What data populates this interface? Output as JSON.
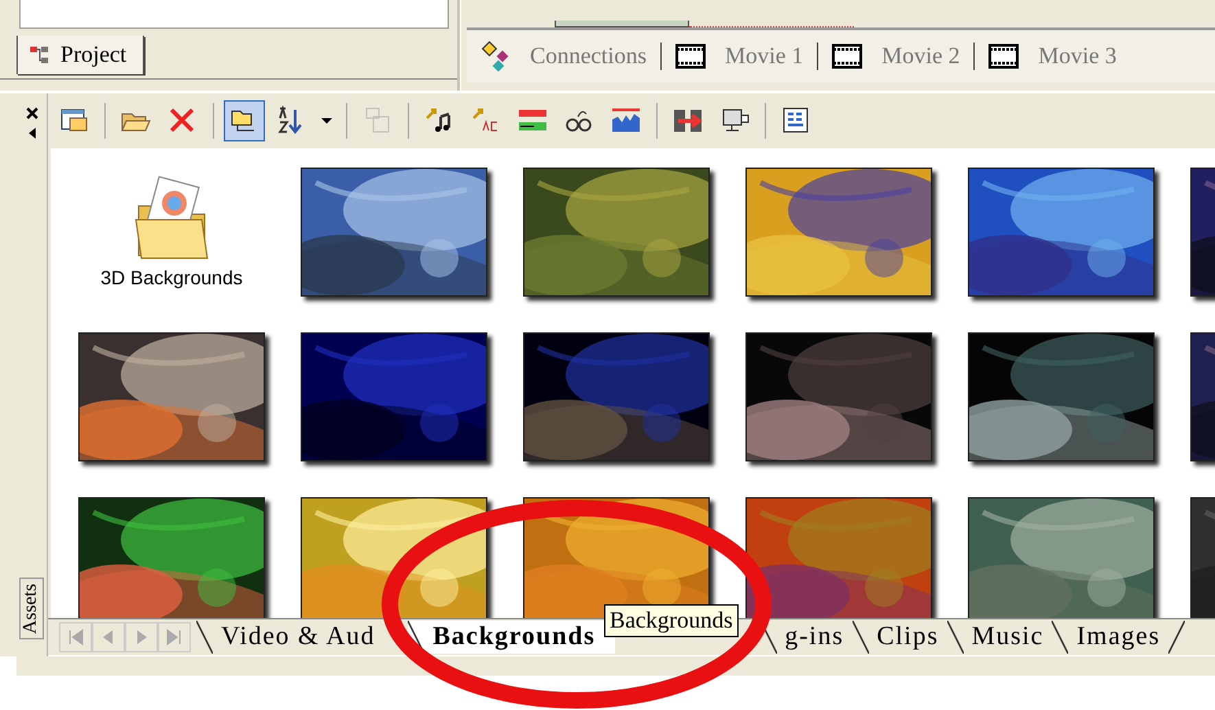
{
  "project_tabs": [
    {
      "label": "Project",
      "selected": true
    }
  ],
  "document_tabs": [
    {
      "kind": "connections",
      "label": "Connections"
    },
    {
      "kind": "movie",
      "label": "Movie 1"
    },
    {
      "kind": "movie",
      "label": "Movie 2"
    },
    {
      "kind": "movie",
      "label": "Movie 3"
    }
  ],
  "toolbar": [
    {
      "kind": "view",
      "selected": false,
      "disabled": false
    },
    {
      "kind": "separator"
    },
    {
      "kind": "open",
      "selected": false,
      "disabled": false
    },
    {
      "kind": "delete",
      "selected": false,
      "disabled": false
    },
    {
      "kind": "separator"
    },
    {
      "kind": "folder-view",
      "selected": true,
      "disabled": false
    },
    {
      "kind": "sort",
      "selected": false,
      "disabled": false
    },
    {
      "kind": "dropdown",
      "selected": false,
      "disabled": false
    },
    {
      "kind": "separator"
    },
    {
      "kind": "windows",
      "selected": false,
      "disabled": true
    },
    {
      "kind": "separator"
    },
    {
      "kind": "audio",
      "selected": false,
      "disabled": false
    },
    {
      "kind": "ac3",
      "selected": false,
      "disabled": false
    },
    {
      "kind": "bars",
      "selected": false,
      "disabled": false
    },
    {
      "kind": "glasses",
      "selected": false,
      "disabled": false
    },
    {
      "kind": "wave",
      "selected": false,
      "disabled": false
    },
    {
      "kind": "separator"
    },
    {
      "kind": "film",
      "selected": false,
      "disabled": false
    },
    {
      "kind": "monitor",
      "selected": false,
      "disabled": false
    },
    {
      "kind": "separator"
    },
    {
      "kind": "grid",
      "selected": false,
      "disabled": false
    }
  ],
  "assets": {
    "title": "Assets",
    "items": [
      {
        "kind": "folder",
        "label": "3D Backgrounds"
      },
      {
        "kind": "picture"
      },
      {
        "kind": "picture"
      },
      {
        "kind": "picture"
      },
      {
        "kind": "picture"
      },
      {
        "kind": "picture"
      },
      {
        "kind": "picture"
      },
      {
        "kind": "picture"
      },
      {
        "kind": "picture"
      },
      {
        "kind": "picture"
      },
      {
        "kind": "picture"
      },
      {
        "kind": "picture"
      },
      {
        "kind": "picture"
      },
      {
        "kind": "picture"
      },
      {
        "kind": "picture"
      },
      {
        "kind": "picture"
      },
      {
        "kind": "picture"
      },
      {
        "kind": "picture"
      }
    ]
  },
  "category_tabs": [
    {
      "label": "Video & Aud",
      "selected": false
    },
    {
      "label": "Backgrounds",
      "selected": true
    },
    {
      "label": "g-ins",
      "selected": false
    },
    {
      "label": "Clips",
      "selected": false
    },
    {
      "label": "Music",
      "selected": false
    },
    {
      "label": "Images",
      "selected": false
    }
  ],
  "tooltip": "Backgrounds"
}
